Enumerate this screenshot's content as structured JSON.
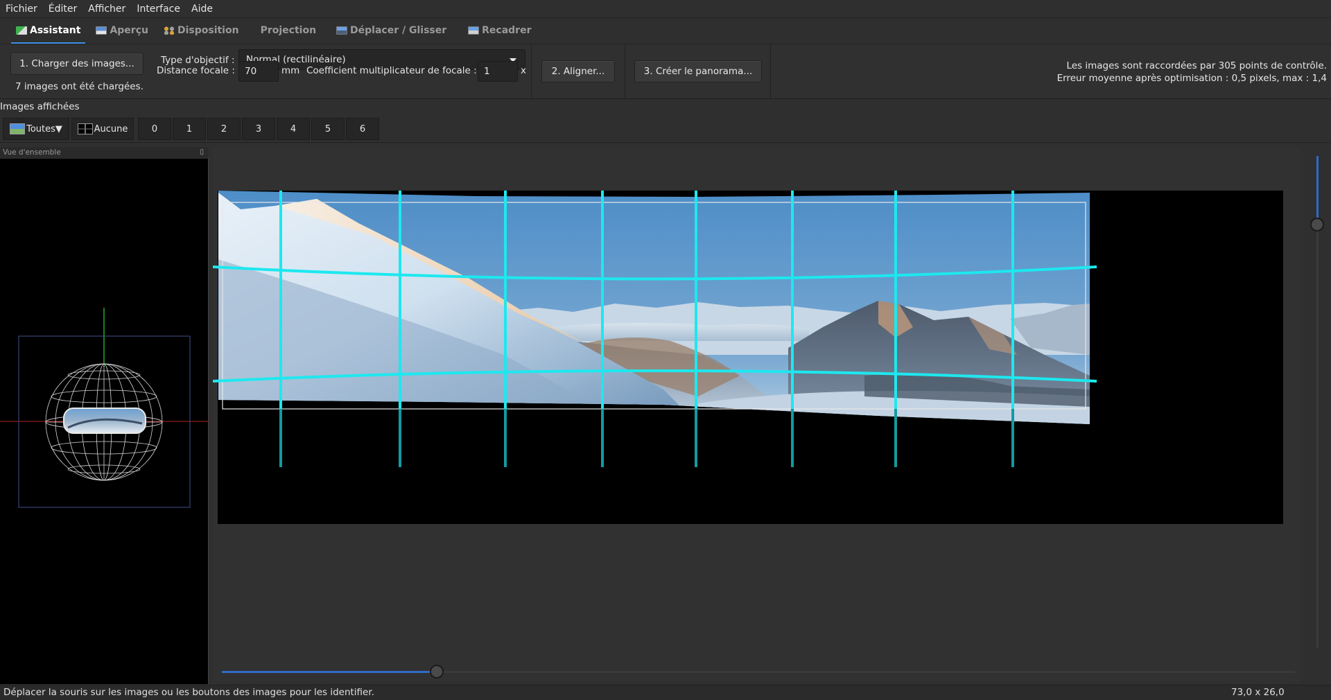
{
  "menu": [
    "Fichier",
    "Éditer",
    "Afficher",
    "Interface",
    "Aide"
  ],
  "tabs": [
    {
      "label": "Assistant",
      "icon": "assistant-icon",
      "active": true
    },
    {
      "label": "Aperçu",
      "icon": "preview-icon",
      "active": false
    },
    {
      "label": "Disposition",
      "icon": "layout-icon",
      "active": false
    },
    {
      "label": "Projection",
      "icon": "",
      "active": false
    },
    {
      "label": "Déplacer / Glisser",
      "icon": "move-drag-icon",
      "active": false
    },
    {
      "label": "Recadrer",
      "icon": "crop-icon",
      "active": false
    }
  ],
  "assistant": {
    "load_button": "1. Charger des images...",
    "loaded_status": "7 images ont été chargées.",
    "lens_type_label": "Type d'objectif  :",
    "lens_type_value": "Normal (rectilinéaire)",
    "focal_length_label": "Distance focale  :",
    "focal_length_value": "70",
    "focal_length_unit": "mm",
    "crop_factor_label": "Coefficient multiplicateur de focale  :",
    "crop_factor_value": "1",
    "crop_factor_unit": "x",
    "align_button": "2. Aligner...",
    "create_button": "3. Créer le panorama...",
    "info_line1": "Les images sont raccordées par 305 points de contrôle.",
    "info_line2": "Erreur moyenne après optimisation  : 0,5 pixels, max  : 1,4"
  },
  "displayed": {
    "title": "Images affichées",
    "all_label": "Toutes",
    "none_label": "Aucune",
    "images": [
      "0",
      "1",
      "2",
      "3",
      "4",
      "5",
      "6"
    ]
  },
  "overview": {
    "title": "Vue d'ensemble",
    "close": "▯"
  },
  "status": {
    "message": "Déplacer la souris sur les images ou les boutons des images pour les identifier.",
    "fov": "73,0 x 26,0"
  },
  "colors": {
    "accent": "#3d8ee6",
    "grid": "#1de8ef"
  }
}
